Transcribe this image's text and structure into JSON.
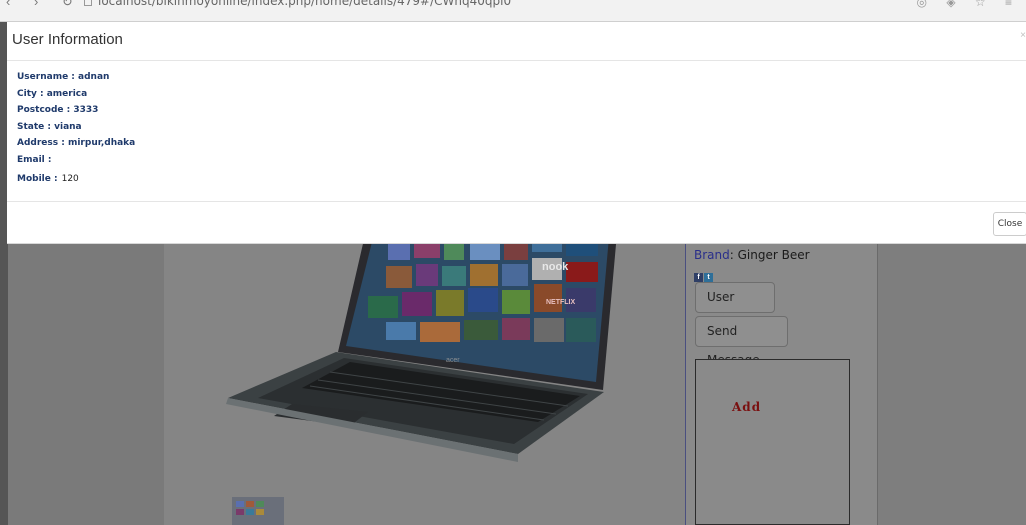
{
  "browser": {
    "url": "localhost/bikinmoyonline/index.php/home/details/479#/CWhq40qpi0"
  },
  "modal": {
    "title": "User Information",
    "fields": {
      "username": "Username : adnan",
      "city": "City : america",
      "postcode": "Postcode : 3333",
      "state": "State : viana",
      "address": "Address : mirpur,dhaka",
      "email": "Email :",
      "mobile_label": "Mobile :",
      "mobile_value": "120"
    },
    "close_label": "Close"
  },
  "page": {
    "brand_key": "Brand",
    "brand_value": ": Ginger Beer",
    "user_details_label": "User Details",
    "send_message_label": "Send Message",
    "ad_text": "Add",
    "laptop_screen_labels": {
      "nook": "nook",
      "netflix": "NETFLIX",
      "acer": "acer"
    }
  },
  "colors": {
    "overlay_bg": "#7f7f7f",
    "label_blue": "#1f3a6b",
    "ad_red": "#7a1010"
  }
}
